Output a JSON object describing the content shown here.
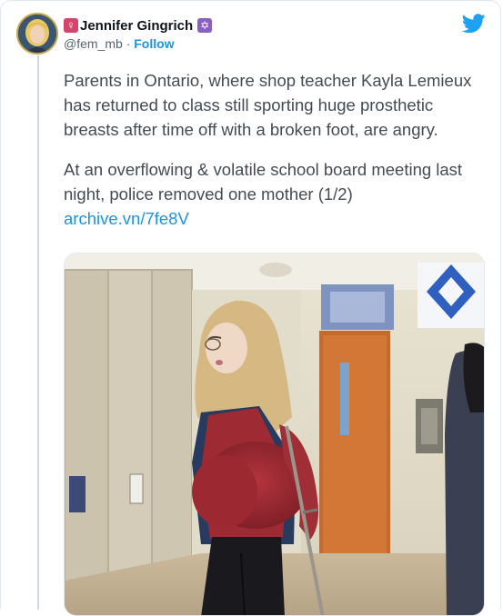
{
  "author": {
    "display_name": "Jennifer Gingrich",
    "handle": "@fem_mb",
    "separator": "·",
    "follow_label": "Follow",
    "name_prefix_icon": "venus-symbol-icon",
    "name_suffix_icon": "star-of-david-icon",
    "avatar_icon": "avatar-photo"
  },
  "brand": {
    "logo_icon": "twitter-bird-icon",
    "accent_color": "#1da1f2",
    "link_color": "#1b95e0"
  },
  "tweet": {
    "paragraphs": [
      "Parents in Ontario, where shop teacher Kayla Lemieux has returned to class still sporting huge prosthetic breasts after time off with a broken foot, are angry.",
      "At an overflowing & volatile school board meeting last night, police removed one mother (1/2)"
    ],
    "link_text": "archive.vn/7fe8V"
  },
  "media": {
    "type": "video-still",
    "scene": "school-hallway-photo"
  }
}
